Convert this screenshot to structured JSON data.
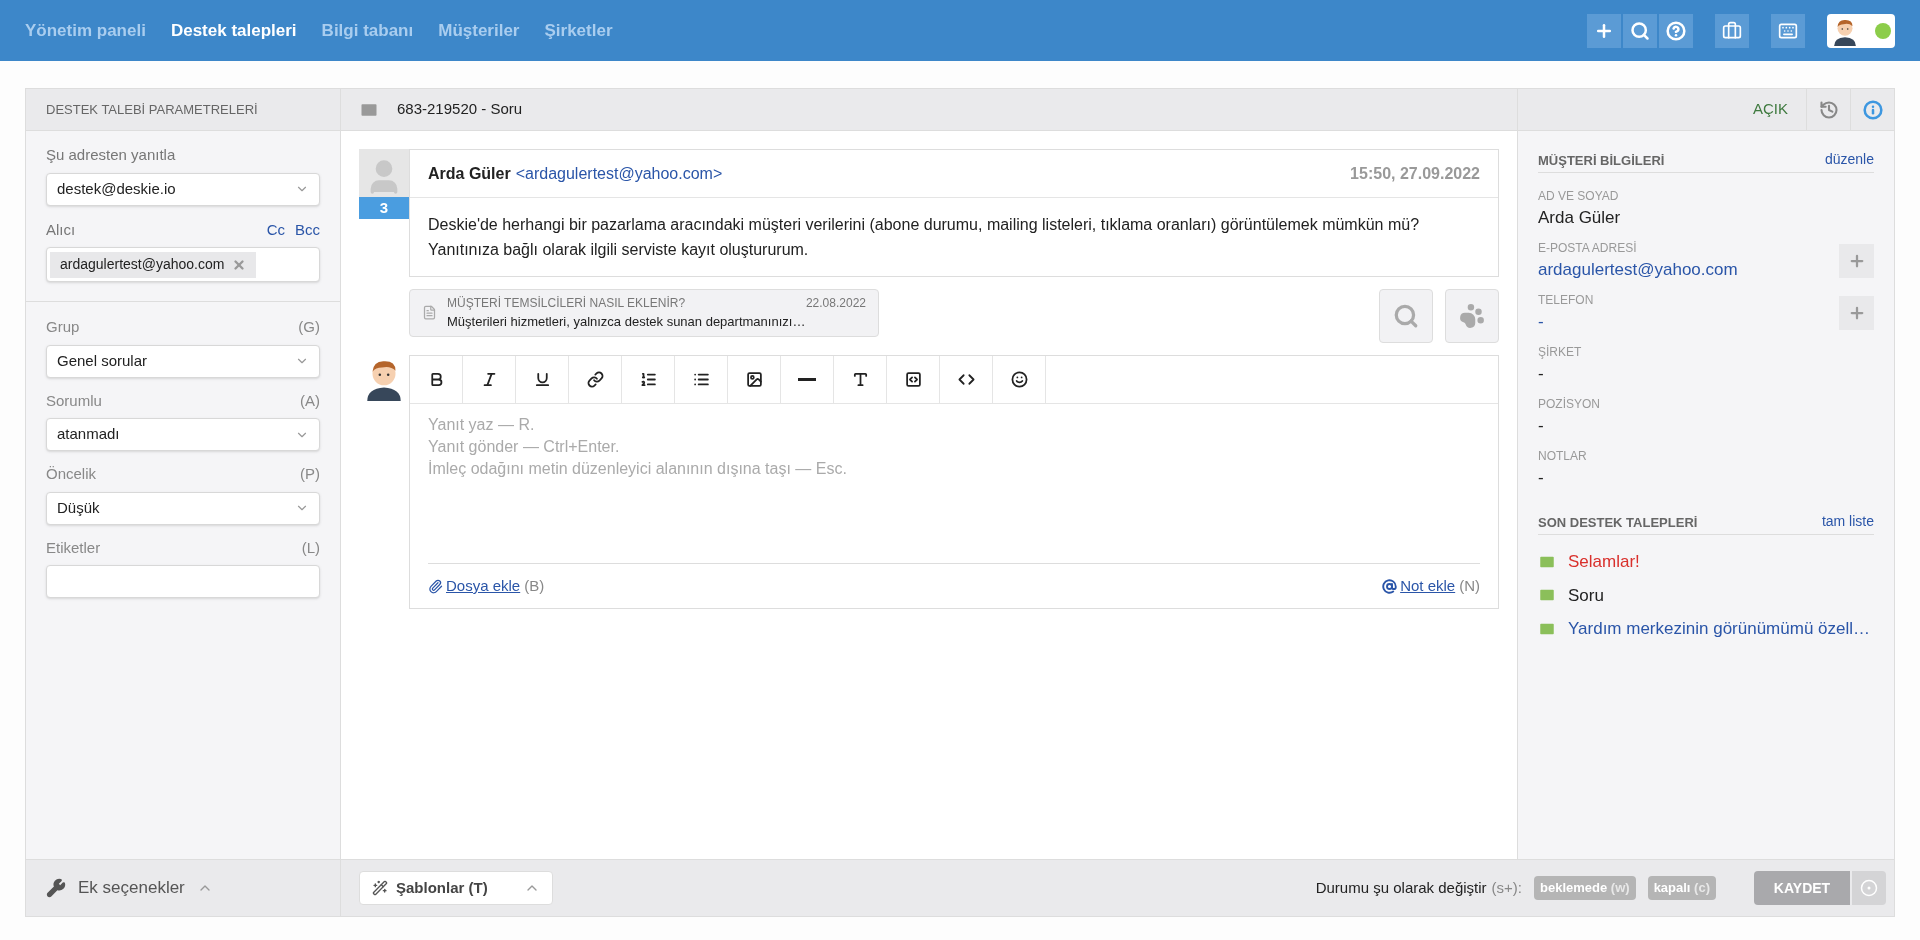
{
  "nav": {
    "items": [
      {
        "label": "Yönetim paneli",
        "selected": false
      },
      {
        "label": "Destek talepleri",
        "selected": true
      },
      {
        "label": "Bilgi tabanı",
        "selected": false
      },
      {
        "label": "Müşteriler",
        "selected": false
      },
      {
        "label": "Şirketler",
        "selected": false
      }
    ],
    "user_online": true
  },
  "left_panel": {
    "title": "DESTEK TALEBİ PARAMETRELERİ",
    "reply_from": {
      "label": "Şu adresten yanıtla",
      "value": "destek@deskie.io"
    },
    "recipient": {
      "label": "Alıcı",
      "cc": "Cc",
      "bcc": "Bcc",
      "tokens": [
        "ardagulertest@yahoo.com"
      ]
    },
    "fields": [
      {
        "kind": "select",
        "label": "Grup",
        "shortcut": "(G)",
        "value": "Genel sorular"
      },
      {
        "kind": "select",
        "label": "Sorumlu",
        "shortcut": "(A)",
        "value": "atanmadı"
      },
      {
        "kind": "select",
        "label": "Öncelik",
        "shortcut": "(P)",
        "value": "Düşük"
      },
      {
        "kind": "input",
        "label": "Etiketler",
        "shortcut": "(L)"
      }
    ],
    "more_options": "Ek seçenekler"
  },
  "ticket": {
    "title": "683-219520 - Soru",
    "status": "AÇIK"
  },
  "message": {
    "author": "Arda Güler",
    "email": "<ardagulertest@yahoo.com>",
    "time": "15:50, 27.09.2022",
    "count": "3",
    "body": "Deskie'de herhangi bir pazarlama aracındaki müşteri verilerini (abone durumu, mailing listeleri, tıklama oranları) görüntülemek mümkün mü? Yanıtınıza bağlı olarak ilgili serviste kayıt oluştururum."
  },
  "suggestion": {
    "title": "MÜŞTERİ TEMSİLCİLERİ NASIL EKLENİR?",
    "date": "22.08.2022",
    "excerpt": "Müşterileri hizmetleri, yalnızca destek sunan departmanınızı…"
  },
  "editor": {
    "placeholder": "Yanıt yaz — R.\nYanıt gönder — Ctrl+Enter.\nİmleç odağını metin düzenleyici alanının dışına taşı — Esc.",
    "attach": {
      "label": "Dosya ekle",
      "shortcut": "(B)"
    },
    "note": {
      "label": "Not ekle",
      "shortcut": "(N)"
    }
  },
  "footer": {
    "templates": "Şablonlar (T)",
    "status_label": "Durumu şu olarak değiştir",
    "status_shortcut": "(s+):",
    "status_buttons": [
      {
        "label": "beklemede",
        "shortcut": "(w)"
      },
      {
        "label": "kapalı",
        "shortcut": "(c)"
      }
    ],
    "save": "KAYDET"
  },
  "customer": {
    "title": "MÜŞTERİ BİLGİLERİ",
    "edit": "düzenle",
    "fields": [
      {
        "kind": "text",
        "label": "AD VE SOYAD",
        "value": "Arda Güler"
      },
      {
        "kind": "link",
        "label": "E-POSTA ADRESİ",
        "value": "ardagulertest@yahoo.com",
        "addable": true
      },
      {
        "kind": "link",
        "label": "TELEFON",
        "value": "-",
        "addable": true
      },
      {
        "kind": "text",
        "label": "ŞİRKET",
        "value": "-"
      },
      {
        "kind": "text",
        "label": "POZİSYON",
        "value": "-"
      },
      {
        "kind": "text",
        "label": "NOTLAR",
        "value": "-"
      }
    ]
  },
  "recent": {
    "title": "SON DESTEK TALEPLERİ",
    "all": "tam liste",
    "items": [
      {
        "label": "Selamlar!",
        "color": "#d9302c"
      },
      {
        "label": "Soru",
        "color": "#222222"
      },
      {
        "label": "Yardım merkezinin görünümümü özell…",
        "color": "#2a55a8"
      }
    ]
  }
}
